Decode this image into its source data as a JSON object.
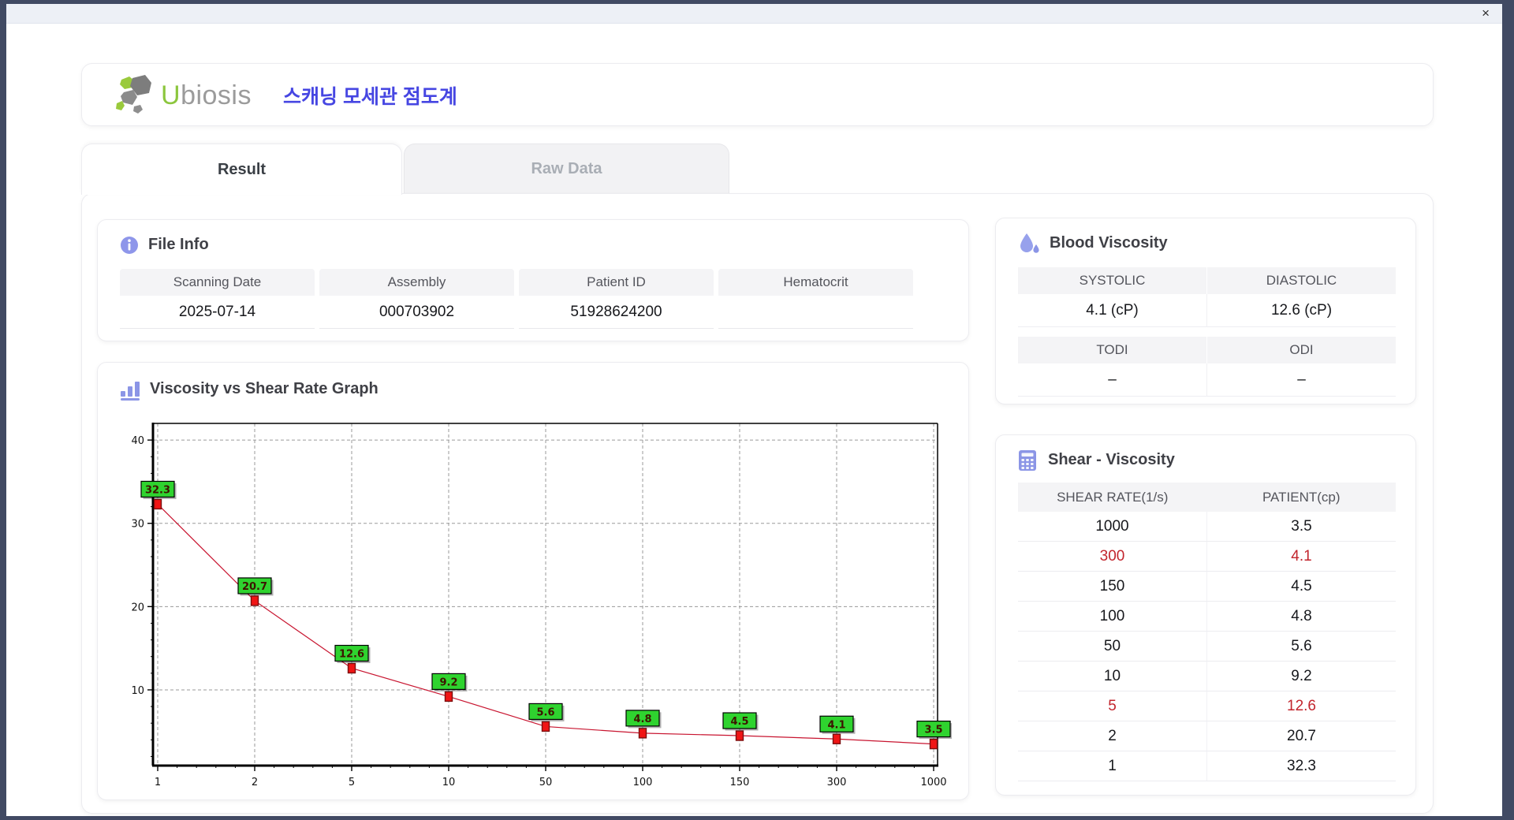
{
  "titlebar": {
    "close_label": "×"
  },
  "header": {
    "logo": {
      "brand_first_letter": "U",
      "brand_rest": "biosis"
    },
    "app_title_korean": "스캐닝 모세관 점도계"
  },
  "tabs": {
    "result": "Result",
    "raw_data": "Raw Data"
  },
  "file_info": {
    "title": "File Info",
    "fields": [
      {
        "label": "Scanning Date",
        "value": "2025-07-14"
      },
      {
        "label": "Assembly",
        "value": "000703902"
      },
      {
        "label": "Patient ID",
        "value": "51928624200"
      },
      {
        "label": "Hematocrit",
        "value": ""
      }
    ]
  },
  "blood_viscosity": {
    "title": "Blood Viscosity",
    "metrics": [
      {
        "label": "SYSTOLIC",
        "value": "4.1 (cP)"
      },
      {
        "label": "DIASTOLIC",
        "value": "12.6 (cP)"
      },
      {
        "label": "TODI",
        "value": "–"
      },
      {
        "label": "ODI",
        "value": "–"
      }
    ]
  },
  "graph": {
    "title": "Viscosity vs Shear Rate Graph"
  },
  "shear_viscosity": {
    "title": "Shear - Viscosity",
    "columns": [
      "SHEAR RATE(1/s)",
      "PATIENT(cp)"
    ],
    "rows": [
      {
        "shear_rate": "1000",
        "patient": "3.5",
        "highlight": false
      },
      {
        "shear_rate": "300",
        "patient": "4.1",
        "highlight": true
      },
      {
        "shear_rate": "150",
        "patient": "4.5",
        "highlight": false
      },
      {
        "shear_rate": "100",
        "patient": "4.8",
        "highlight": false
      },
      {
        "shear_rate": "50",
        "patient": "5.6",
        "highlight": false
      },
      {
        "shear_rate": "10",
        "patient": "9.2",
        "highlight": false
      },
      {
        "shear_rate": "5",
        "patient": "12.6",
        "highlight": true
      },
      {
        "shear_rate": "2",
        "patient": "20.7",
        "highlight": false
      },
      {
        "shear_rate": "1",
        "patient": "32.3",
        "highlight": false
      }
    ],
    "highlight_color": "#c2252d"
  },
  "chart_data": {
    "type": "line",
    "x_scale": "categorical",
    "categories": [
      "1",
      "2",
      "5",
      "10",
      "50",
      "100",
      "150",
      "300",
      "1000"
    ],
    "values": [
      32.3,
      20.7,
      12.6,
      9.2,
      5.6,
      4.8,
      4.5,
      4.1,
      3.5
    ],
    "point_labels": [
      "32.3",
      "20.7",
      "12.6",
      "9.2",
      "5.6",
      "4.8",
      "4.5",
      "4.1",
      "3.5"
    ],
    "title": "Viscosity vs Shear Rate Graph",
    "xlabel": "",
    "ylabel": "",
    "yticks": [
      10,
      20,
      30,
      40
    ],
    "ylim": [
      1,
      42
    ],
    "grid": "dashed",
    "legend": "none",
    "line_color": "#c81530",
    "marker_shape": "square",
    "marker_color": "#f01515",
    "marker_border": "#7c0f0f",
    "point_label_bg": "#2fd32f",
    "point_label_text": "#3c1400"
  }
}
